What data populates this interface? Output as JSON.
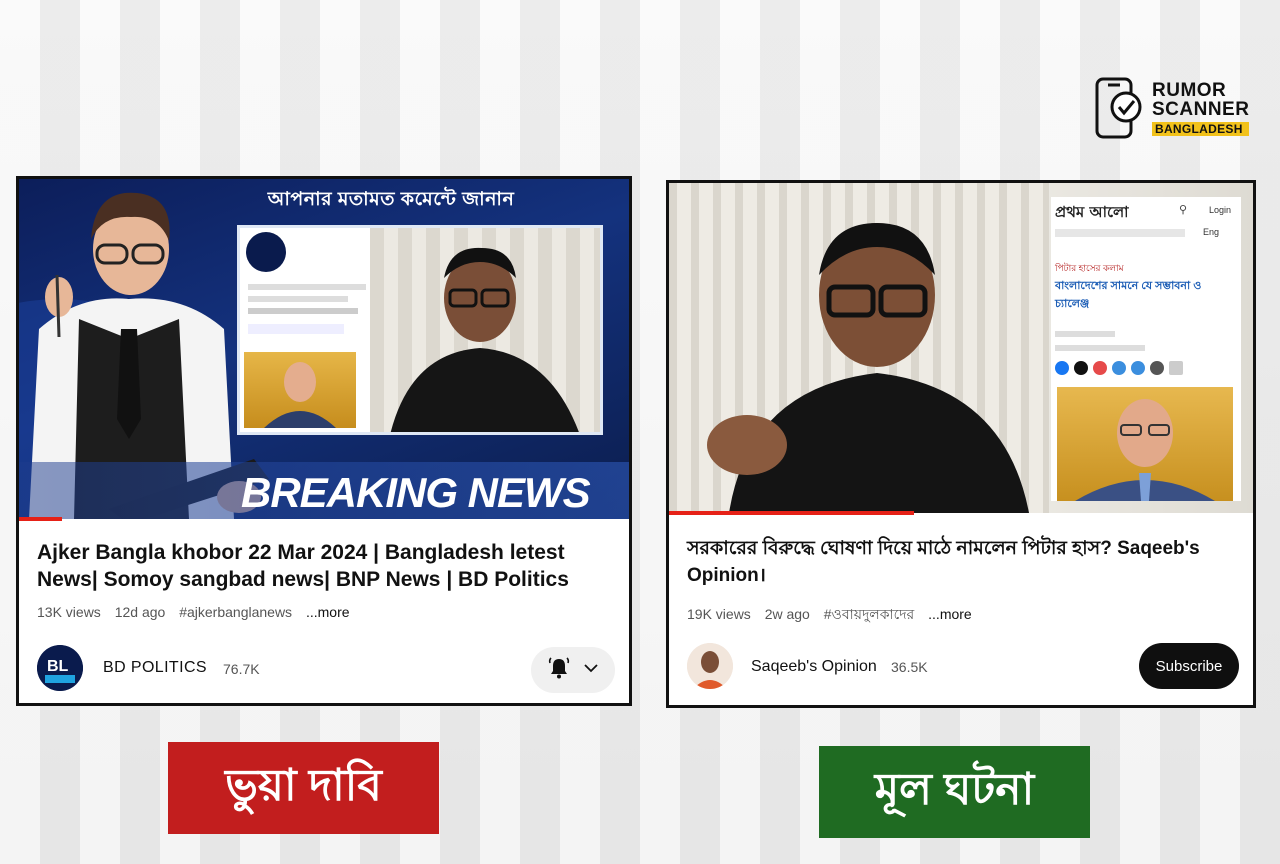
{
  "brand": {
    "line1": "RUMOR",
    "line2": "SCANNER",
    "line3": "BANGLADESH"
  },
  "left_video": {
    "thumbnail_banner": "আপনার মতামত কমেন্টে জানান",
    "thumbnail_breaking": "BREAKING NEWS",
    "title": "Ajker Bangla khobor 22 Mar 2024 | Bangladesh letest News| Somoy sangbad news| BNP News | BD Politics",
    "views": "13K views",
    "age": "12d ago",
    "hashtag": "#ajkerbanglanews",
    "more": "...more",
    "channel_name": "BD POLITICS",
    "subscribers": "76.7K",
    "progress_fraction": 0.07,
    "icons": [
      "bell-ringing-icon",
      "chevron-down-icon"
    ]
  },
  "right_video": {
    "site_logo": "প্রথম আলো",
    "site_login": "Login",
    "site_lang": "Eng",
    "site_kicker": "পিটার হাসের কলাম",
    "site_headline": "বাংলাদেশের সামনে যে সম্ভাবনা ও চ্যালেঞ্জ",
    "title": "সরকারের বিরুদ্ধে ঘোষণা দিয়ে মাঠে নামলেন পিটার হাস? Saqeeb's Opinion।",
    "views": "19K views",
    "age": "2w ago",
    "hashtag": "#ওবায়দুলকাদের",
    "more": "...more",
    "channel_name": "Saqeeb's Opinion",
    "subscribers": "36.5K",
    "subscribe_label": "Subscribe",
    "progress_fraction": 0.42
  },
  "labels": {
    "fake_claim": "ভুয়া দাবি",
    "real_event": "মূল ঘটনা"
  },
  "colors": {
    "fake": "#c21e1e",
    "real": "#1f6b22",
    "progress": "#e62117",
    "brand_accent": "#f2c21b"
  }
}
